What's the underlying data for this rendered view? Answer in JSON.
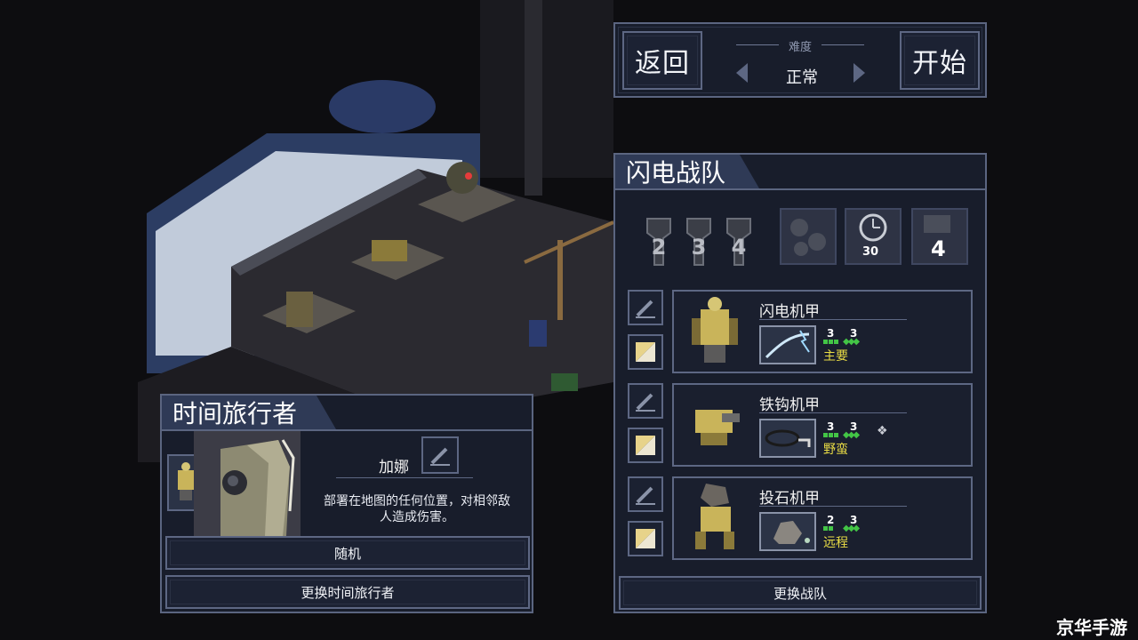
{
  "topbar": {
    "back_label": "返回",
    "start_label": "开始",
    "difficulty_label": "难度",
    "difficulty_value": "正常"
  },
  "squad": {
    "title": "闪电战队",
    "slot_numbers": [
      "2",
      "3",
      "4"
    ],
    "pilot_badges": [
      {
        "icon": "pilots-group-icon",
        "value": ""
      },
      {
        "icon": "clock-icon",
        "value": "30"
      },
      {
        "icon": "grid-mech-icon",
        "value": "4"
      }
    ],
    "mechs": [
      {
        "name": "闪电机甲",
        "stat_a": "3",
        "stat_b": "3",
        "role": "主要",
        "weapon_icon": "lightning-whip-icon",
        "portrait_icon": "lightning-mech-icon"
      },
      {
        "name": "铁钩机甲",
        "stat_a": "3",
        "stat_b": "3",
        "role": "野蛮",
        "weapon_icon": "grappling-hook-icon",
        "portrait_icon": "hook-mech-icon"
      },
      {
        "name": "投石机甲",
        "stat_a": "2",
        "stat_b": "3",
        "role": "远程",
        "weapon_icon": "rock-launcher-icon",
        "portrait_icon": "boulder-mech-icon"
      }
    ],
    "change_label": "更换战队"
  },
  "pilot": {
    "title": "时间旅行者",
    "name": "加娜",
    "description_line1": "部署在地图的任何位置，对相邻敌",
    "description_line2": "人造成伤害。",
    "random_label": "随机",
    "change_label": "更换时间旅行者"
  },
  "watermark": "京华手游",
  "colors": {
    "panel_bg": "#181d2b",
    "panel_border": "#5b6580",
    "title_tab": "#2f3a56",
    "accent_green": "#43c546",
    "role_yellow": "#e9dc45"
  }
}
